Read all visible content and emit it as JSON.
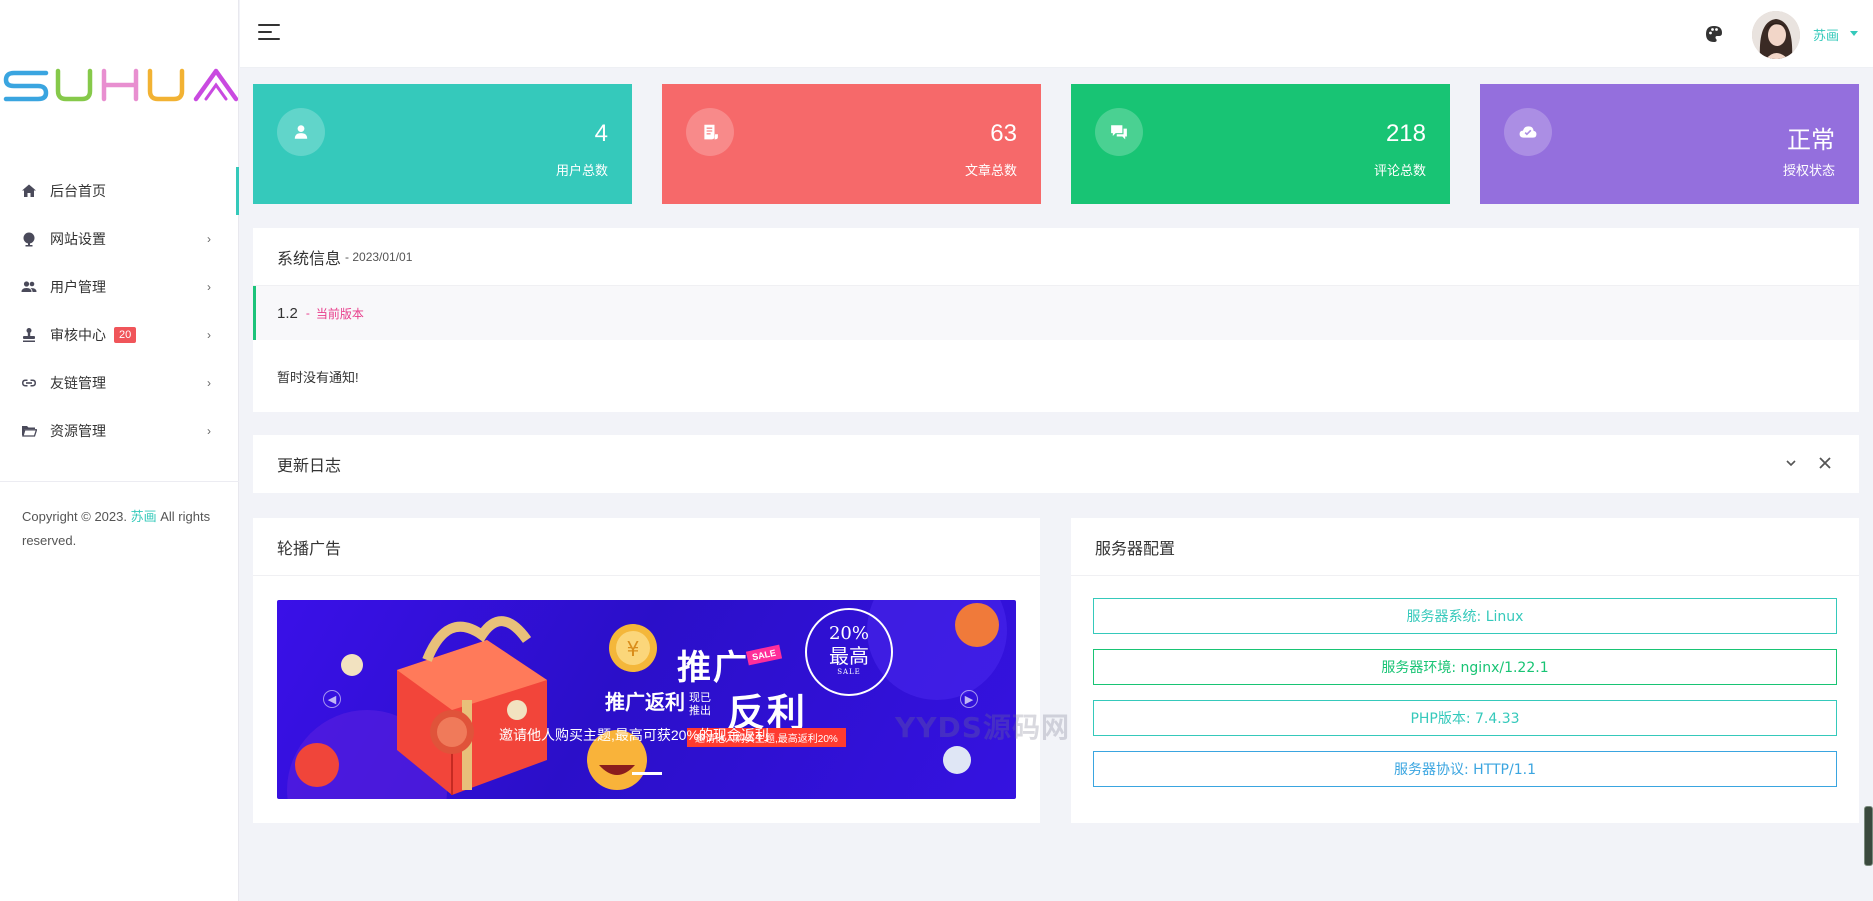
{
  "brand": {
    "logo_text": "SUHUA"
  },
  "sidebar": {
    "items": [
      {
        "label": "后台首页",
        "icon": "home-icon"
      },
      {
        "label": "网站设置",
        "icon": "globe-icon",
        "arrow": "›"
      },
      {
        "label": "用户管理",
        "icon": "users-icon",
        "arrow": "›"
      },
      {
        "label": "审核中心",
        "icon": "stamp-icon",
        "badge": "20",
        "arrow": "›"
      },
      {
        "label": "友链管理",
        "icon": "link-icon",
        "arrow": "›"
      },
      {
        "label": "资源管理",
        "icon": "folder-icon",
        "arrow": "›"
      }
    ],
    "copyright_prefix": "Copyright © 2023.",
    "copyright_brand": "苏画",
    "copyright_suffix": "All rights reserved."
  },
  "header": {
    "username": "苏画"
  },
  "stats": [
    {
      "value": "4",
      "label": "用户总数",
      "color": "#35c9bb",
      "icon": "user-icon"
    },
    {
      "value": "63",
      "label": "文章总数",
      "color": "#f6696a",
      "icon": "article-icon"
    },
    {
      "value": "218",
      "label": "评论总数",
      "color": "#18c474",
      "icon": "comment-icon"
    },
    {
      "value": "正常",
      "label": "授权状态",
      "color": "#946fdd",
      "icon": "cloud-check-icon"
    }
  ],
  "system_info": {
    "title": "系统信息",
    "date": "- 2023/01/01",
    "version": "1.2",
    "version_sep": "-",
    "version_tag": "当前版本",
    "notice": "暂时没有通知!"
  },
  "changelog": {
    "title": "更新日志"
  },
  "carousel": {
    "title": "轮播广告",
    "caption": "邀请他人购买主题,最高可获20%的现金返利",
    "banner_title_1": "推广",
    "banner_title_2": "反利",
    "banner_sub": "推广返利",
    "banner_sub_small_1": "现已",
    "banner_sub_small_2": "推出",
    "stamp_percent": "20%",
    "stamp_main": "最高",
    "stamp_sale": "SALE",
    "sale_tag": "SALE",
    "ribbon": "邀请他人购买主题,最高返利20%"
  },
  "watermark": "YYDS源码网",
  "server": {
    "title": "服务器配置",
    "items": [
      {
        "text": "服务器系统: Linux",
        "color": "#35c9bb"
      },
      {
        "text": "服务器环境: nginx/1.22.1",
        "color": "#18c474"
      },
      {
        "text": "PHP版本: 7.4.33",
        "color": "#35c9bb"
      },
      {
        "text": "服务器协议: HTTP/1.1",
        "color": "#3aa5e0"
      }
    ]
  }
}
